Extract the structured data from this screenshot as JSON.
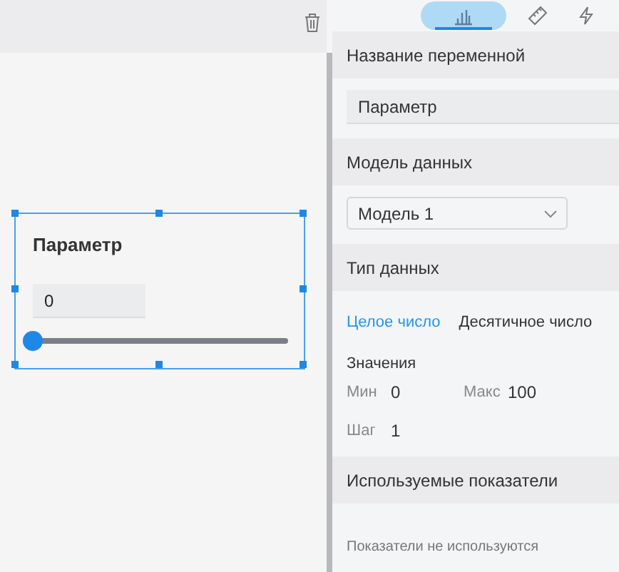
{
  "canvas": {
    "widget": {
      "title": "Параметр",
      "value": "0",
      "slider": {
        "level": 0
      }
    }
  },
  "panel": {
    "tabs": [
      {
        "kind": "chart",
        "selected": true
      },
      {
        "kind": "ruler",
        "selected": false
      },
      {
        "kind": "bolt",
        "selected": false
      }
    ],
    "name_section": {
      "header": "Название переменной",
      "value": "Параметр"
    },
    "model_section": {
      "header": "Модель данных",
      "value": "Модель 1"
    },
    "type_section": {
      "header": "Тип данных",
      "options": [
        {
          "label": "Целое число",
          "selected": true
        },
        {
          "label": "Десятичное число",
          "selected": false
        }
      ],
      "values_label": "Значения",
      "min_label": "Мин",
      "min": "0",
      "max_label": "Макс",
      "max": "100",
      "step_label": "Шаг",
      "step": "1"
    },
    "indicators_section": {
      "header": "Используемые показатели",
      "empty_text": "Показатели не используются"
    }
  }
}
